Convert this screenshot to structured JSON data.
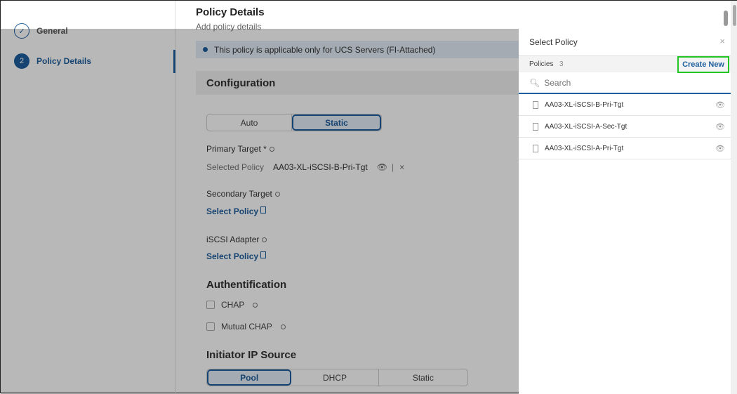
{
  "wizard": {
    "steps": [
      {
        "label": "General",
        "state": "done"
      },
      {
        "label": "Policy Details",
        "number": "2",
        "state": "active"
      }
    ]
  },
  "page": {
    "title": "Policy Details",
    "subtitle": "Add policy details",
    "banner": "This policy is applicable only for UCS Servers (FI-Attached)",
    "section": "Configuration"
  },
  "mode": {
    "options": [
      "Auto",
      "Static"
    ],
    "selected": "Static"
  },
  "primary": {
    "label": "Primary Target *",
    "selected_label": "Selected Policy",
    "value": "AA03-XL-iSCSI-B-Pri-Tgt"
  },
  "secondary": {
    "label": "Secondary Target",
    "link": "Select Policy"
  },
  "adapter": {
    "label": "iSCSI Adapter",
    "link": "Select Policy"
  },
  "auth": {
    "title": "Authentification",
    "chap": "CHAP",
    "mutual": "Mutual CHAP"
  },
  "initiator": {
    "title": "Initiator IP Source",
    "options": [
      "Pool",
      "DHCP",
      "Static"
    ],
    "selected": "Pool"
  },
  "panel": {
    "title": "Select Policy",
    "close": "×",
    "policies_label": "Policies",
    "count": "3",
    "create": "Create New",
    "search_placeholder": "Search",
    "items": [
      "AA03-XL-iSCSI-B-Pri-Tgt",
      "AA03-XL-iSCSI-A-Sec-Tgt",
      "AA03-XL-iSCSI-A-Pri-Tgt"
    ]
  },
  "colors": {
    "accent": "#1f5f9e",
    "highlight": "#22c522"
  }
}
